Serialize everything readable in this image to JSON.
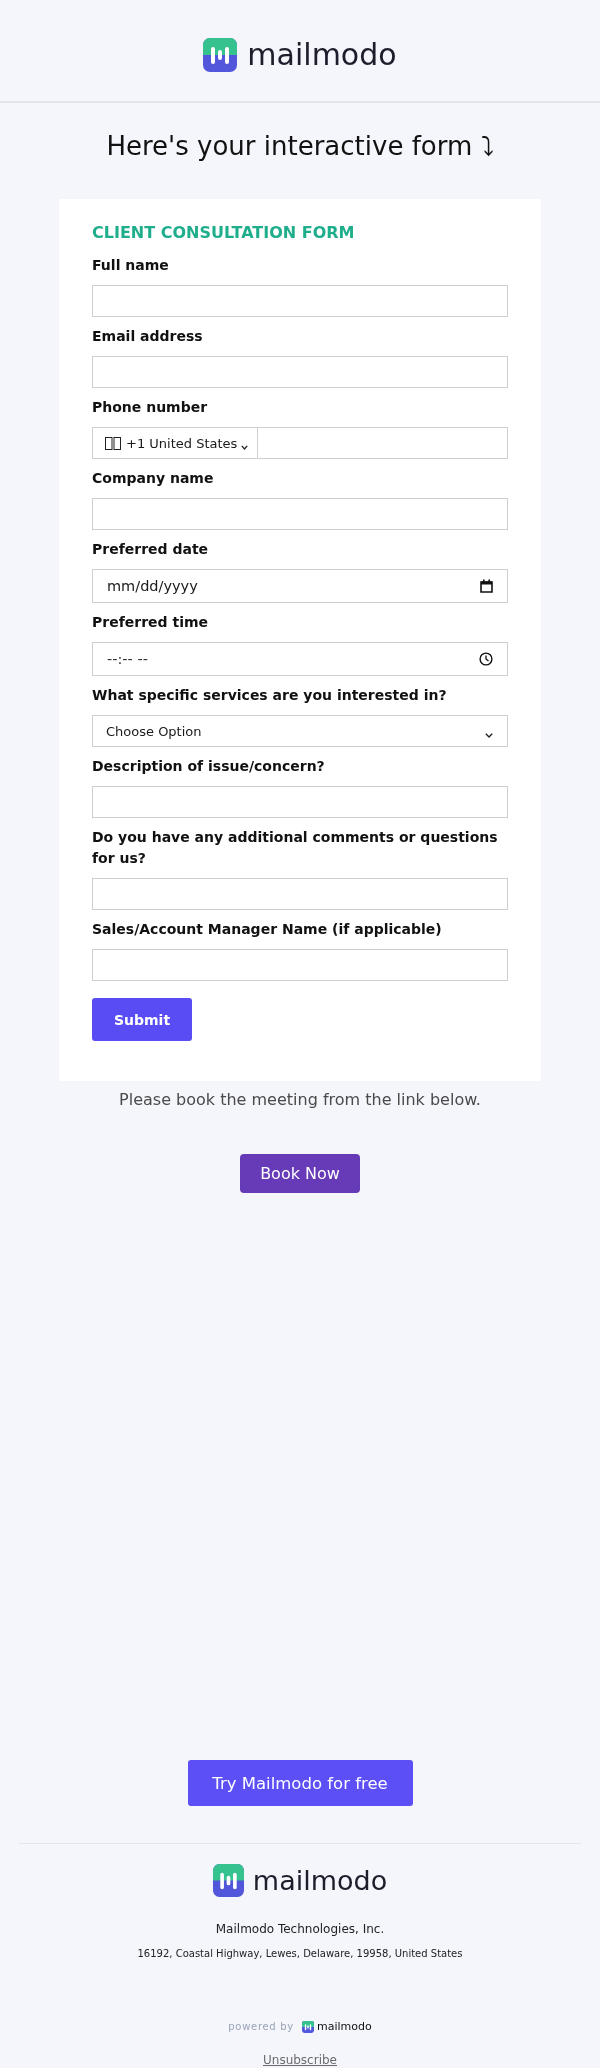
{
  "header": {
    "brand": "mailmodo"
  },
  "heading": "Here's your interactive form ⤵",
  "form": {
    "title": "CLIENT CONSULTATION FORM",
    "fields": [
      {
        "kind": "text",
        "label": "Full name"
      },
      {
        "kind": "text",
        "label": "Email address"
      },
      {
        "kind": "phone",
        "label": "Phone number",
        "country": "+1 United States"
      },
      {
        "kind": "text",
        "label": "Company name"
      },
      {
        "kind": "date",
        "label": "Preferred date",
        "placeholder": "mm/dd/yyyy"
      },
      {
        "kind": "time",
        "label": "Preferred time",
        "placeholder": "--:-- --"
      },
      {
        "kind": "select",
        "label": "What specific services are you interested in?",
        "value": "Choose Option"
      },
      {
        "kind": "text",
        "label": "Description of issue/concern?"
      },
      {
        "kind": "text",
        "label": "Do you have any additional comments or questions for us?"
      },
      {
        "kind": "text",
        "label": "Sales/Account Manager Name (if applicable)"
      }
    ],
    "submit": "Submit"
  },
  "booking": {
    "note": "Please book the meeting from the link below.",
    "button": "Book Now"
  },
  "cta": {
    "button": "Try Mailmodo for free"
  },
  "footer": {
    "brand": "mailmodo",
    "company": "Mailmodo Technologies, Inc.",
    "address": "16192, Coastal Highway, Lewes, Delaware, 19958, United States",
    "powered_by": "powered by",
    "powered_brand": "mailmodo",
    "unsubscribe": "Unsubscribe"
  }
}
